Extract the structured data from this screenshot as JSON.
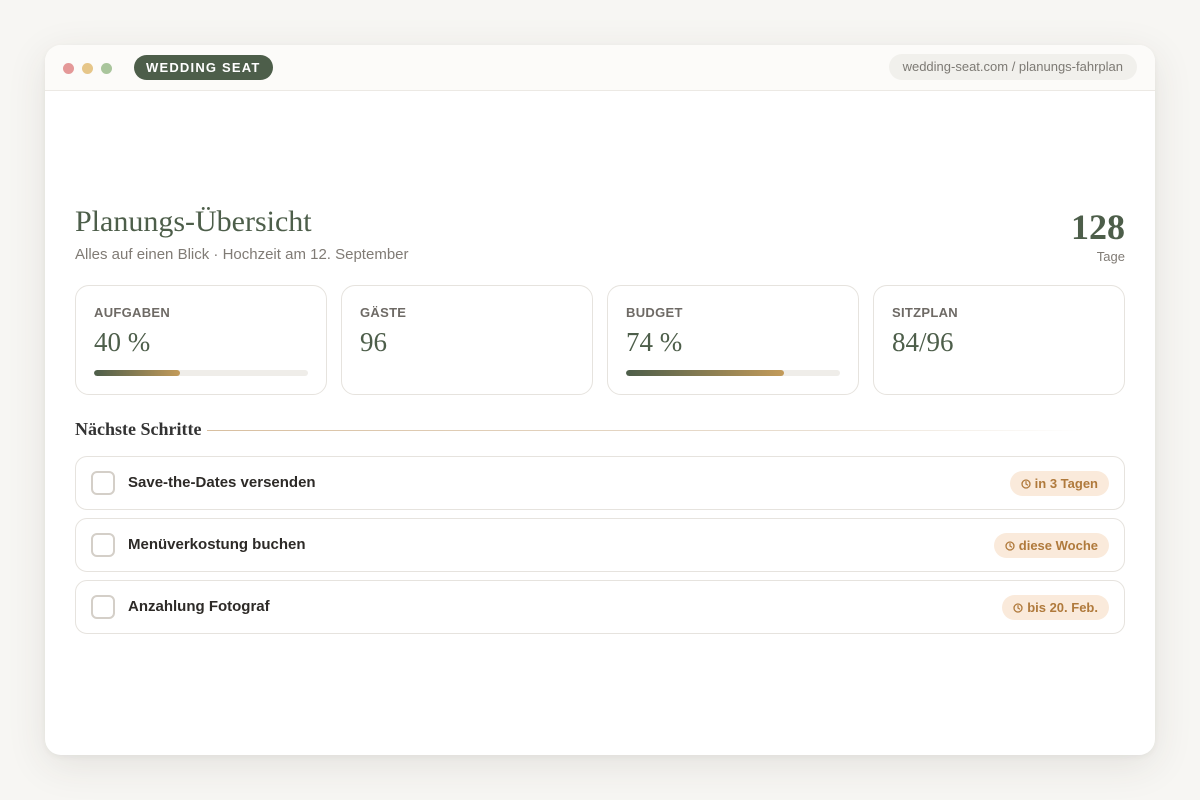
{
  "browser": {
    "brand": "WEDDING SEAT",
    "url": "wedding-seat.com / planungs-fahrplan"
  },
  "header": {
    "title": "Planungs-Übersicht",
    "subtitle": "Alles auf einen Blick · Hochzeit am 12. September",
    "countdown_value": "128",
    "countdown_label": "Tage"
  },
  "stats": [
    {
      "label": "AUFGABEN",
      "value": "40 %",
      "progress": 0.4
    },
    {
      "label": "GÄSTE",
      "value": "96"
    },
    {
      "label": "BUDGET",
      "value": "74 %",
      "progress": 0.74
    },
    {
      "label": "SITZPLAN",
      "value": "84/96"
    }
  ],
  "next_steps": {
    "title": "Nächste Schritte",
    "tasks": [
      {
        "label": "Save-the-Dates versenden",
        "due": "in 3 Tagen",
        "icon": "clock-icon"
      },
      {
        "label": "Menüverkostung buchen",
        "due": "diese Woche",
        "icon": "clock-icon"
      },
      {
        "label": "Anzahlung Fotograf",
        "due": "bis 20. Feb.",
        "icon": "clock-icon"
      }
    ]
  },
  "colors": {
    "primary": "#4d5e4a",
    "accent": "#c39b5a",
    "badge_bg": "#faeadb",
    "badge_text": "#b07a3c"
  }
}
